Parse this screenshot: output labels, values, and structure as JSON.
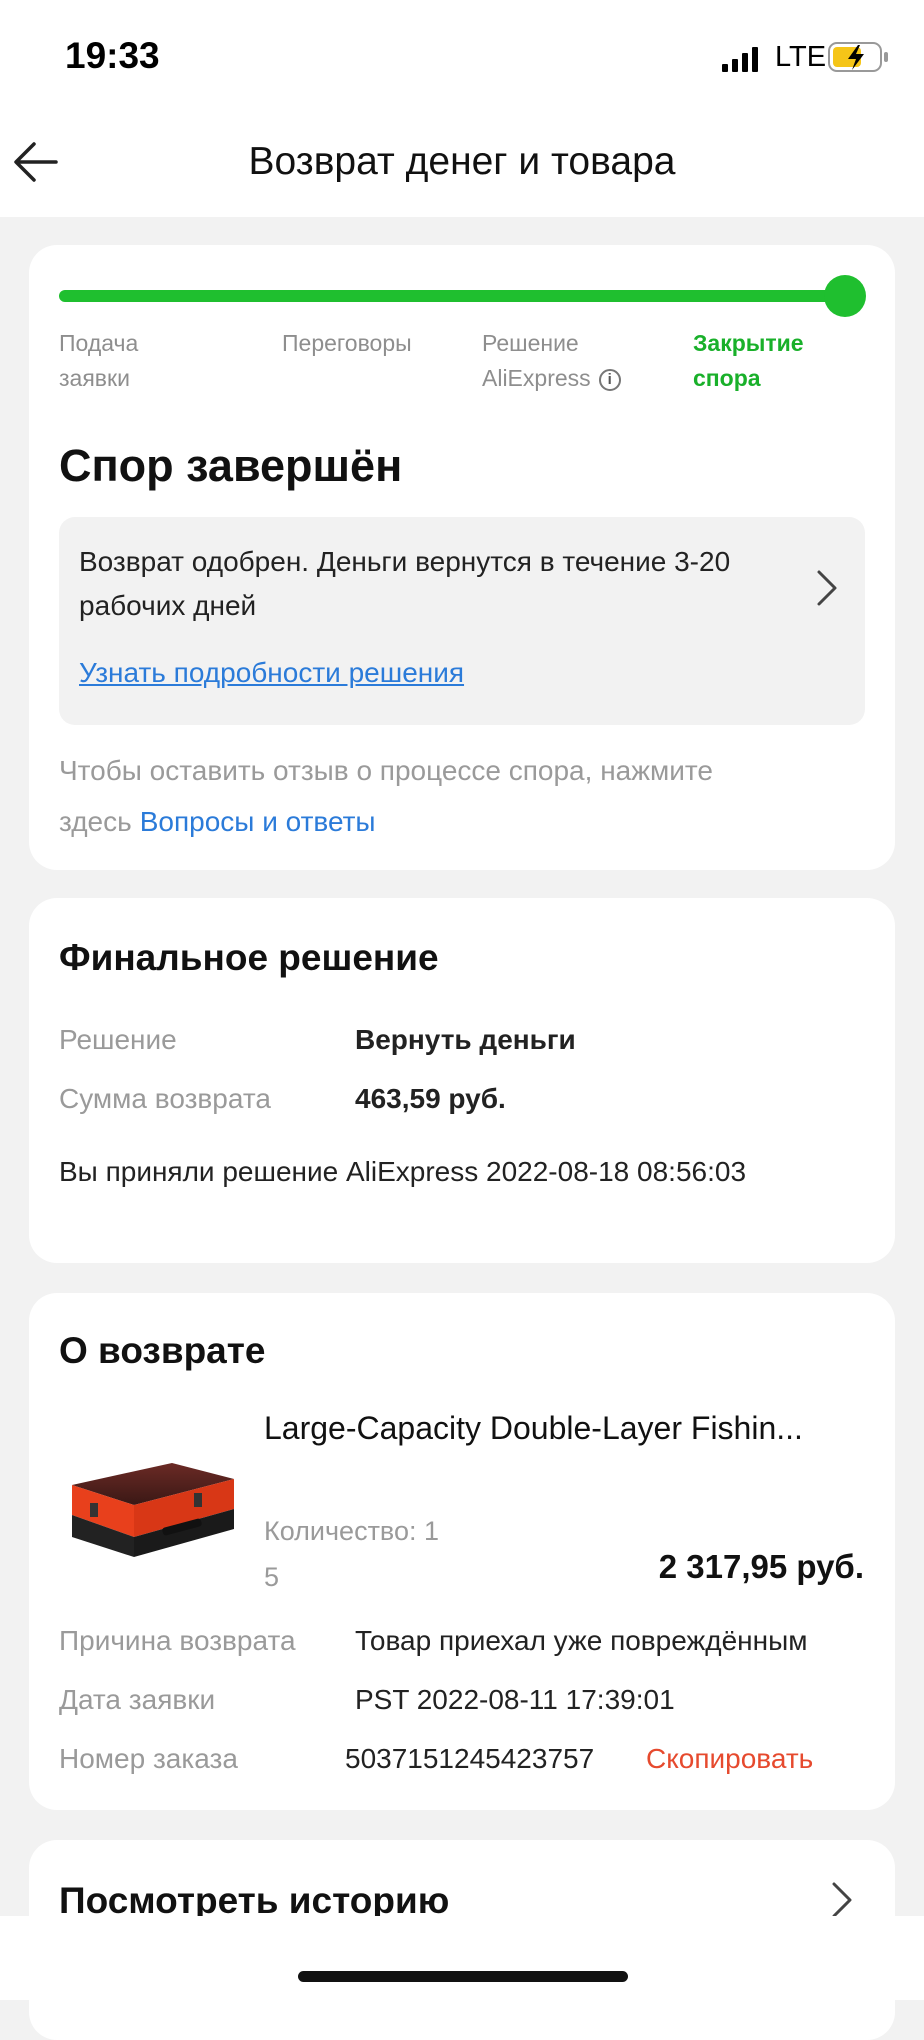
{
  "status": {
    "time": "19:33",
    "network": "LTE"
  },
  "header": {
    "title": "Возврат денег и товара"
  },
  "progress": {
    "steps": [
      {
        "label_line1": "Подача",
        "label_line2": "заявки"
      },
      {
        "label_line1": "Переговоры",
        "label_line2": ""
      },
      {
        "label_line1": "Решение",
        "label_line2": "AliExpress"
      },
      {
        "label_line1": "Закрытие",
        "label_line2": "спора"
      }
    ],
    "current_step": 4,
    "accent": "#1fbf2f"
  },
  "dispute": {
    "title": "Спор завершён",
    "notice_text": "Возврат одобрен. Деньги вернутся в течение 3-20 рабочих дней",
    "notice_link": "Узнать подробности решения",
    "feedback_text": "Чтобы оставить отзыв о процессе спора, нажмите здесь",
    "feedback_link": "Вопросы и ответы"
  },
  "final_decision": {
    "title": "Финальное решение",
    "rows": [
      {
        "label": "Решение",
        "value": "Вернуть деньги"
      },
      {
        "label": "Сумма возврата",
        "value": "463,59 руб."
      }
    ],
    "accepted_text": "Вы приняли решение AliExpress 2022-08-18 08:56:03"
  },
  "refund": {
    "title": "О возврате",
    "product_title": "Large-Capacity Double-Layer Fishin...",
    "quantity_line1": "Количество: 1",
    "quantity_line2": "5",
    "price": "2 317,95 руб.",
    "rows": [
      {
        "label": "Причина возврата",
        "value": "Товар приехал уже повреждённым"
      },
      {
        "label": "Дата заявки",
        "value": "PST 2022-08-11 17:39:01"
      },
      {
        "label": "Номер заказа",
        "value": "5037151245423757"
      }
    ],
    "copy_label": "Скопировать"
  },
  "history": {
    "title": "Посмотреть историю"
  },
  "icons": {
    "back": "arrow-left-icon",
    "chevron": "chevron-right-icon",
    "info": "info-icon",
    "signal": "cellular-signal-icon",
    "battery": "battery-charging-icon"
  },
  "colors": {
    "link": "#2b7bd9",
    "copy": "#e64a2e",
    "active_step": "#19b02a"
  }
}
